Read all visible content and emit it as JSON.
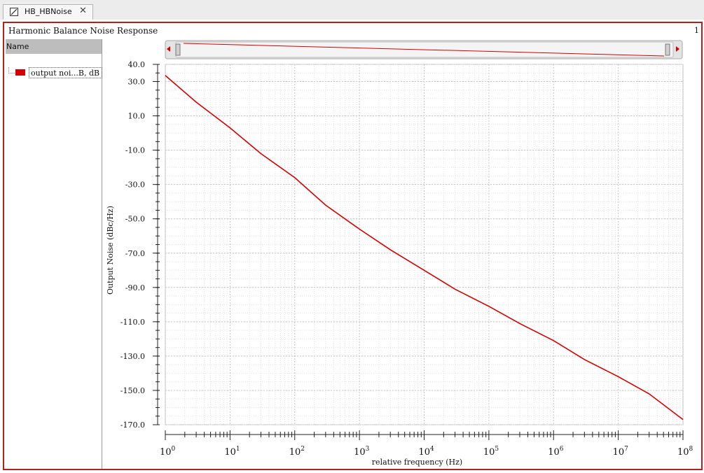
{
  "tab": {
    "label": "HB_HBNoise",
    "close": "✕",
    "icon": "graph-window-icon"
  },
  "window": {
    "title": "Harmonic Balance Noise Response",
    "subwindow_number": "1"
  },
  "sidebar": {
    "header": "Name",
    "trace_label": "output noi...B, dB",
    "trace_color": "#d40000"
  },
  "colors": {
    "accent": "#b42020",
    "trace": "#d40000",
    "grid": "#c8c8c8"
  },
  "chart_data": {
    "type": "line",
    "title": "",
    "xlabel": "relative frequency (Hz)",
    "ylabel": "Output Noise (dBc/Hz)",
    "xscale": "log",
    "xlim": [
      1,
      100000000
    ],
    "ylim": [
      -170,
      40
    ],
    "grid": true,
    "xticks": [
      {
        "value": 1,
        "base": "10",
        "exp": "0"
      },
      {
        "value": 10,
        "base": "10",
        "exp": "1"
      },
      {
        "value": 100,
        "base": "10",
        "exp": "2"
      },
      {
        "value": 1000,
        "base": "10",
        "exp": "3"
      },
      {
        "value": 10000,
        "base": "10",
        "exp": "4"
      },
      {
        "value": 100000,
        "base": "10",
        "exp": "5"
      },
      {
        "value": 1000000,
        "base": "10",
        "exp": "6"
      },
      {
        "value": 10000000,
        "base": "10",
        "exp": "7"
      },
      {
        "value": 100000000,
        "base": "10",
        "exp": "8"
      }
    ],
    "yticks": [
      {
        "value": 40,
        "label": "40.0"
      },
      {
        "value": 30,
        "label": "30.0"
      },
      {
        "value": 10,
        "label": "10.0"
      },
      {
        "value": -10,
        "label": "-10.0"
      },
      {
        "value": -30,
        "label": "-30.0"
      },
      {
        "value": -50,
        "label": "-50.0"
      },
      {
        "value": -70,
        "label": "-70.0"
      },
      {
        "value": -90,
        "label": "-90.0"
      },
      {
        "value": -110,
        "label": "-110.0"
      },
      {
        "value": -130,
        "label": "-130.0"
      },
      {
        "value": -150,
        "label": "-150.0"
      },
      {
        "value": -170,
        "label": "-170.0"
      }
    ],
    "series": [
      {
        "name": "output noi...B, dB",
        "color": "#d40000",
        "x": [
          1,
          3,
          10,
          30,
          100,
          300,
          1000,
          3000,
          10000,
          30000,
          100000,
          300000,
          1000000,
          3000000,
          10000000,
          30000000,
          100000000
        ],
        "y": [
          33.5,
          18,
          3,
          -12,
          -26,
          -42,
          -56,
          -68,
          -80,
          -91,
          -101,
          -111,
          -121,
          -132,
          -142,
          -152,
          -167
        ]
      }
    ]
  }
}
